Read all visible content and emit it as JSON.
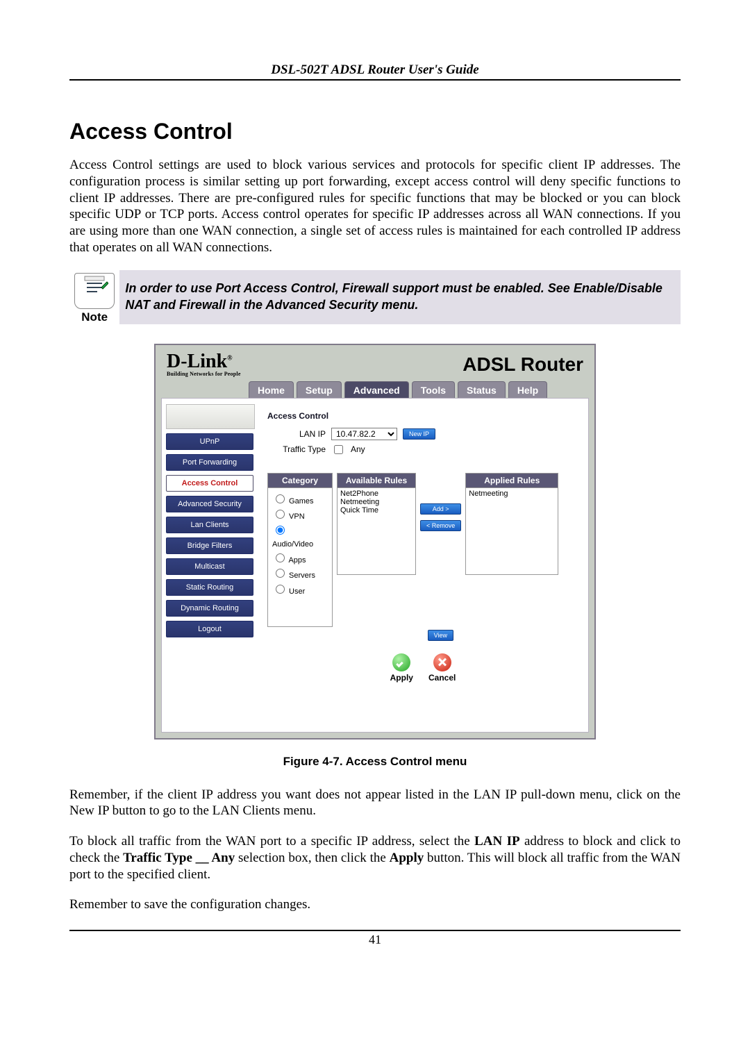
{
  "header_title": "DSL-502T ADSL Router User's Guide",
  "h1": "Access Control",
  "intro": "Access Control settings are used to block various services and protocols for specific client IP addresses. The configuration process is similar setting up port forwarding, except access control will deny specific functions to client IP addresses. There are pre-configured rules for specific functions that may be blocked or you can block specific UDP or TCP ports.  Access control operates for specific IP addresses across all WAN connections. If you are using more than one WAN connection, a single set of access rules is maintained for each controlled IP address that operates on all WAN connections.",
  "note_label": "Note",
  "note_text": "In order to use Port Access Control, Firewall support must be enabled. See Enable/Disable NAT and Firewall in the Advanced Security menu.",
  "brand_tagline": "Building Networks for People",
  "brand_name": "D-Link",
  "device_title": "ADSL Router",
  "tabs": [
    "Home",
    "Setup",
    "Advanced",
    "Tools",
    "Status",
    "Help"
  ],
  "tab_active_index": 2,
  "side_items": [
    "UPnP",
    "Port Forwarding",
    "Access Control",
    "Advanced Security",
    "Lan Clients",
    "Bridge Filters",
    "Multicast",
    "Static Routing",
    "Dynamic Routing",
    "Logout"
  ],
  "side_active_index": 2,
  "panel_title": "Access Control",
  "lan_ip": {
    "label": "LAN IP",
    "value": "10.47.82.2",
    "new_btn": "New IP"
  },
  "traffic": {
    "label": "Traffic Type",
    "check_label": "Any"
  },
  "columns": {
    "category": "Category",
    "available": "Available Rules",
    "applied": "Applied Rules"
  },
  "categories": [
    "Games",
    "VPN",
    "Audio/Video",
    "Apps",
    "Servers",
    "User"
  ],
  "category_selected_index": 2,
  "available_rules": [
    "Net2Phone",
    "Netmeeting",
    "Quick Time"
  ],
  "applied_rules": [
    "Netmeeting"
  ],
  "btn_add": "Add >",
  "btn_remove": "< Remove",
  "btn_view": "View",
  "btn_apply": "Apply",
  "btn_cancel": "Cancel",
  "figure_caption": "Figure 4-7. Access Control menu",
  "p_remember1": "Remember, if the client IP address you want does not appear listed in the LAN IP pull-down menu, click on the New IP button to go to the LAN Clients menu.",
  "p_block_pre": "To block all traffic from the WAN port to a specific IP address, select the ",
  "p_block_b1": "LAN IP",
  "p_block_mid1": " address to block and click to check the ",
  "p_block_b2": "Traffic Type __ Any",
  "p_block_mid2": " selection box, then click the ",
  "p_block_b3": "Apply",
  "p_block_end": " button. This will block all traffic from the WAN port to the specified client.",
  "p_remember2": "Remember to save the configuration changes.",
  "page_no": "41"
}
